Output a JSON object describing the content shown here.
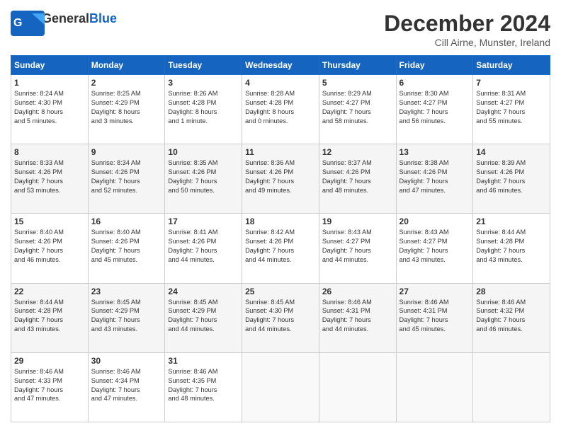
{
  "header": {
    "logo_general": "General",
    "logo_blue": "Blue",
    "title": "December 2024",
    "subtitle": "Cill Airne, Munster, Ireland"
  },
  "calendar": {
    "days_of_week": [
      "Sunday",
      "Monday",
      "Tuesday",
      "Wednesday",
      "Thursday",
      "Friday",
      "Saturday"
    ],
    "weeks": [
      [
        {
          "day": "1",
          "info": "Sunrise: 8:24 AM\nSunset: 4:30 PM\nDaylight: 8 hours\nand 5 minutes."
        },
        {
          "day": "2",
          "info": "Sunrise: 8:25 AM\nSunset: 4:29 PM\nDaylight: 8 hours\nand 3 minutes."
        },
        {
          "day": "3",
          "info": "Sunrise: 8:26 AM\nSunset: 4:28 PM\nDaylight: 8 hours\nand 1 minute."
        },
        {
          "day": "4",
          "info": "Sunrise: 8:28 AM\nSunset: 4:28 PM\nDaylight: 8 hours\nand 0 minutes."
        },
        {
          "day": "5",
          "info": "Sunrise: 8:29 AM\nSunset: 4:27 PM\nDaylight: 7 hours\nand 58 minutes."
        },
        {
          "day": "6",
          "info": "Sunrise: 8:30 AM\nSunset: 4:27 PM\nDaylight: 7 hours\nand 56 minutes."
        },
        {
          "day": "7",
          "info": "Sunrise: 8:31 AM\nSunset: 4:27 PM\nDaylight: 7 hours\nand 55 minutes."
        }
      ],
      [
        {
          "day": "8",
          "info": "Sunrise: 8:33 AM\nSunset: 4:26 PM\nDaylight: 7 hours\nand 53 minutes."
        },
        {
          "day": "9",
          "info": "Sunrise: 8:34 AM\nSunset: 4:26 PM\nDaylight: 7 hours\nand 52 minutes."
        },
        {
          "day": "10",
          "info": "Sunrise: 8:35 AM\nSunset: 4:26 PM\nDaylight: 7 hours\nand 50 minutes."
        },
        {
          "day": "11",
          "info": "Sunrise: 8:36 AM\nSunset: 4:26 PM\nDaylight: 7 hours\nand 49 minutes."
        },
        {
          "day": "12",
          "info": "Sunrise: 8:37 AM\nSunset: 4:26 PM\nDaylight: 7 hours\nand 48 minutes."
        },
        {
          "day": "13",
          "info": "Sunrise: 8:38 AM\nSunset: 4:26 PM\nDaylight: 7 hours\nand 47 minutes."
        },
        {
          "day": "14",
          "info": "Sunrise: 8:39 AM\nSunset: 4:26 PM\nDaylight: 7 hours\nand 46 minutes."
        }
      ],
      [
        {
          "day": "15",
          "info": "Sunrise: 8:40 AM\nSunset: 4:26 PM\nDaylight: 7 hours\nand 46 minutes."
        },
        {
          "day": "16",
          "info": "Sunrise: 8:40 AM\nSunset: 4:26 PM\nDaylight: 7 hours\nand 45 minutes."
        },
        {
          "day": "17",
          "info": "Sunrise: 8:41 AM\nSunset: 4:26 PM\nDaylight: 7 hours\nand 44 minutes."
        },
        {
          "day": "18",
          "info": "Sunrise: 8:42 AM\nSunset: 4:26 PM\nDaylight: 7 hours\nand 44 minutes."
        },
        {
          "day": "19",
          "info": "Sunrise: 8:43 AM\nSunset: 4:27 PM\nDaylight: 7 hours\nand 44 minutes."
        },
        {
          "day": "20",
          "info": "Sunrise: 8:43 AM\nSunset: 4:27 PM\nDaylight: 7 hours\nand 43 minutes."
        },
        {
          "day": "21",
          "info": "Sunrise: 8:44 AM\nSunset: 4:28 PM\nDaylight: 7 hours\nand 43 minutes."
        }
      ],
      [
        {
          "day": "22",
          "info": "Sunrise: 8:44 AM\nSunset: 4:28 PM\nDaylight: 7 hours\nand 43 minutes."
        },
        {
          "day": "23",
          "info": "Sunrise: 8:45 AM\nSunset: 4:29 PM\nDaylight: 7 hours\nand 43 minutes."
        },
        {
          "day": "24",
          "info": "Sunrise: 8:45 AM\nSunset: 4:29 PM\nDaylight: 7 hours\nand 44 minutes."
        },
        {
          "day": "25",
          "info": "Sunrise: 8:45 AM\nSunset: 4:30 PM\nDaylight: 7 hours\nand 44 minutes."
        },
        {
          "day": "26",
          "info": "Sunrise: 8:46 AM\nSunset: 4:31 PM\nDaylight: 7 hours\nand 44 minutes."
        },
        {
          "day": "27",
          "info": "Sunrise: 8:46 AM\nSunset: 4:31 PM\nDaylight: 7 hours\nand 45 minutes."
        },
        {
          "day": "28",
          "info": "Sunrise: 8:46 AM\nSunset: 4:32 PM\nDaylight: 7 hours\nand 46 minutes."
        }
      ],
      [
        {
          "day": "29",
          "info": "Sunrise: 8:46 AM\nSunset: 4:33 PM\nDaylight: 7 hours\nand 47 minutes."
        },
        {
          "day": "30",
          "info": "Sunrise: 8:46 AM\nSunset: 4:34 PM\nDaylight: 7 hours\nand 47 minutes."
        },
        {
          "day": "31",
          "info": "Sunrise: 8:46 AM\nSunset: 4:35 PM\nDaylight: 7 hours\nand 48 minutes."
        },
        {
          "day": "",
          "info": ""
        },
        {
          "day": "",
          "info": ""
        },
        {
          "day": "",
          "info": ""
        },
        {
          "day": "",
          "info": ""
        }
      ]
    ]
  }
}
